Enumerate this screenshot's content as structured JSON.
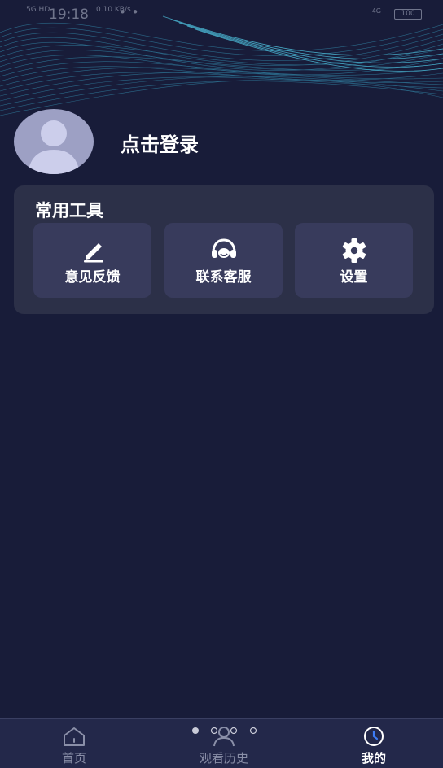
{
  "status_bar": {
    "network": "5G HD",
    "time": "19:18",
    "signal_info": "0.10 KB/s",
    "more_dots": "• •",
    "network_right": "4G",
    "battery": "100"
  },
  "profile": {
    "login_label": "点击登录"
  },
  "tools": {
    "title": "常用工具",
    "items": [
      {
        "label": "意见反馈",
        "icon": "edit-pen-icon"
      },
      {
        "label": "联系客服",
        "icon": "headset-icon"
      },
      {
        "label": "设置",
        "icon": "gear-icon"
      }
    ]
  },
  "tabbar": {
    "tabs": [
      {
        "label": "首页",
        "icon": "home-icon",
        "active": false
      },
      {
        "label": "观看历史",
        "icon": "user-icon",
        "active": false
      },
      {
        "label": "我的",
        "icon": "clock-icon",
        "active": true
      }
    ]
  },
  "colors": {
    "background": "#181c39",
    "card": "#2c3048",
    "tool_tile": "#383b5c",
    "tabbar": "#23284a",
    "accent_blue": "#3d7cf5",
    "wave": "#3aa7c9"
  }
}
